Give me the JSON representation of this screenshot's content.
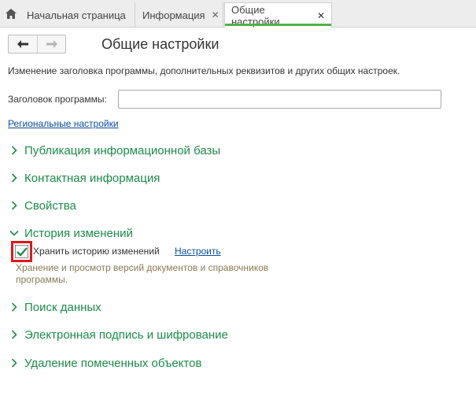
{
  "tabs": [
    {
      "label": "Начальная страница",
      "closable": false,
      "active": false
    },
    {
      "label": "Информация",
      "closable": true,
      "active": false
    },
    {
      "label": "Общие настройки",
      "closable": true,
      "active": true
    }
  ],
  "icons": {
    "home": "home-icon",
    "close": "close-icon",
    "back": "arrow-left-icon",
    "forward": "arrow-right-icon",
    "expand": "chevron-right-icon",
    "collapse": "chevron-down-icon",
    "check": "checkmark-icon"
  },
  "colors": {
    "accent_green": "#1b8b4b",
    "link_blue": "#0b4ea2",
    "active_tab_underline": "#4fb247",
    "highlight_red": "#e01818",
    "note_text": "#8a7a55"
  },
  "page": {
    "title": "Общие настройки",
    "description": "Изменение заголовка программы, дополнительных реквизитов и других общих настроек."
  },
  "title_field": {
    "label": "Заголовок программы:",
    "value": "",
    "placeholder": ""
  },
  "regional_link": "Региональные настройки",
  "sections": {
    "publication": "Публикация информационной базы",
    "contact_info": "Контактная информация",
    "properties": "Свойства",
    "history": "История изменений",
    "search": "Поиск данных",
    "signature": "Электронная подпись и шифрование",
    "deletion": "Удаление помеченных объектов"
  },
  "history": {
    "checkbox_label": "Хранить историю изменений",
    "checked": true,
    "configure_link": "Настроить",
    "note": "Хранение и просмотр версий документов и справочников программы."
  }
}
